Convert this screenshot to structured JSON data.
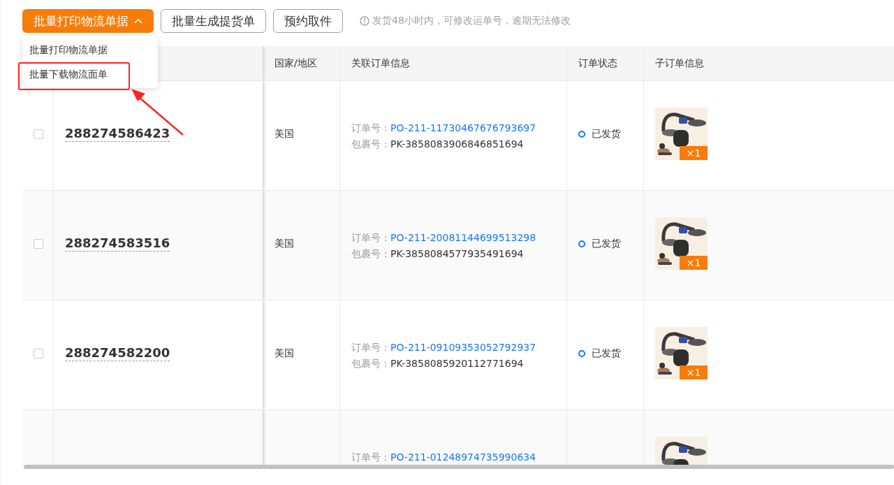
{
  "toolbar": {
    "print_button": {
      "label": "批量打印物流单据",
      "expanded": true
    },
    "buttons": [
      "批量生成提货单",
      "预约取件"
    ],
    "hint": "发货48小时内，可修改运单号，逾期无法修改"
  },
  "dropdown": {
    "items": [
      {
        "label": "批量打印物流单据",
        "highlighted": false
      },
      {
        "label": "批量下载物流面单",
        "highlighted": true
      }
    ]
  },
  "table": {
    "columns": [
      "国家/地区",
      "关联订单信息",
      "订单状态",
      "子订单信息"
    ],
    "rows": [
      {
        "checked": false,
        "logistics_no": "288274586423",
        "country": "美国",
        "order_label": "订单号：",
        "order_no": "PO-211-11730467676793697",
        "package_label": "包裹号：",
        "package_no": "PK-3858083906846851694",
        "status": "已发货",
        "quantity": "×1"
      },
      {
        "checked": false,
        "logistics_no": "288274583516",
        "country": "美国",
        "order_label": "订单号：",
        "order_no": "PO-211-20081144699513298",
        "package_label": "包裹号：",
        "package_no": "PK-3858084577935491694",
        "status": "已发货",
        "quantity": "×1"
      },
      {
        "checked": false,
        "logistics_no": "288274582200",
        "country": "美国",
        "order_label": "订单号：",
        "order_no": "PO-211-09109353052792937",
        "package_label": "包裹号：",
        "package_no": "PK-3858085920112771694",
        "status": "已发货",
        "quantity": "×1"
      },
      {
        "order_label": "订单号：",
        "order_no": "PO-211-01248974735990634"
      }
    ]
  }
}
